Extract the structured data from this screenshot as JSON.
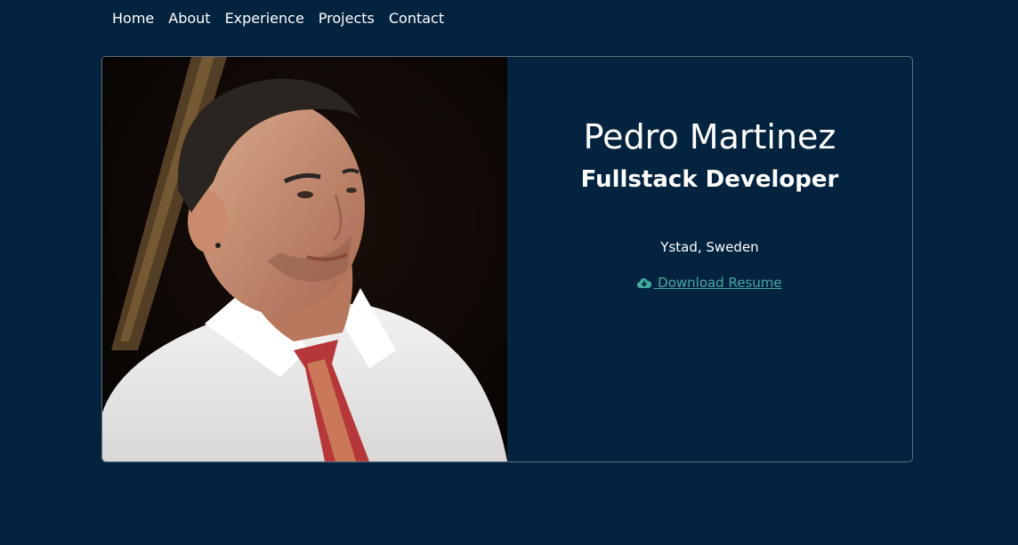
{
  "nav": {
    "items": [
      {
        "label": "Home"
      },
      {
        "label": "About"
      },
      {
        "label": "Experience"
      },
      {
        "label": "Projects"
      },
      {
        "label": "Contact"
      }
    ]
  },
  "profile": {
    "name": "Pedro Martinez",
    "role": "Fullstack Developer",
    "location": "Ystad, Sweden",
    "resume_label": " Download Resume",
    "resume_icon": "cloud-download-icon",
    "link_color": "#41a99f"
  },
  "colors": {
    "background": "#04233f",
    "card_border": "#5d6f80"
  }
}
